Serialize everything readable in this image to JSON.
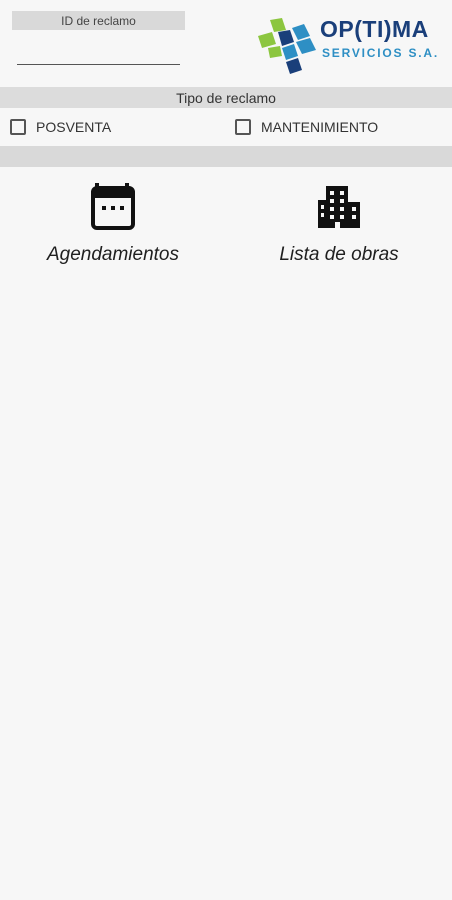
{
  "claim_id": {
    "label": "ID de reclamo",
    "value": "",
    "placeholder": ""
  },
  "logo": {
    "title": "OP(TI)MA",
    "subtitle": "SERVICIOS S.A."
  },
  "claim_type": {
    "header": "Tipo de reclamo",
    "options": [
      {
        "label": "POSVENTA",
        "checked": false
      },
      {
        "label": "MANTENIMIENTO",
        "checked": false
      }
    ]
  },
  "menu": {
    "items": [
      {
        "label": "Agendamientos",
        "icon": "calendar-icon"
      },
      {
        "label": "Lista de obras",
        "icon": "building-icon"
      }
    ]
  },
  "colors": {
    "background": "#f7f7f7",
    "header_bar": "#dcdcdc",
    "logo_navy": "#1a3f7a",
    "logo_blue": "#2e8fc4",
    "logo_green": "#8cc63f"
  }
}
